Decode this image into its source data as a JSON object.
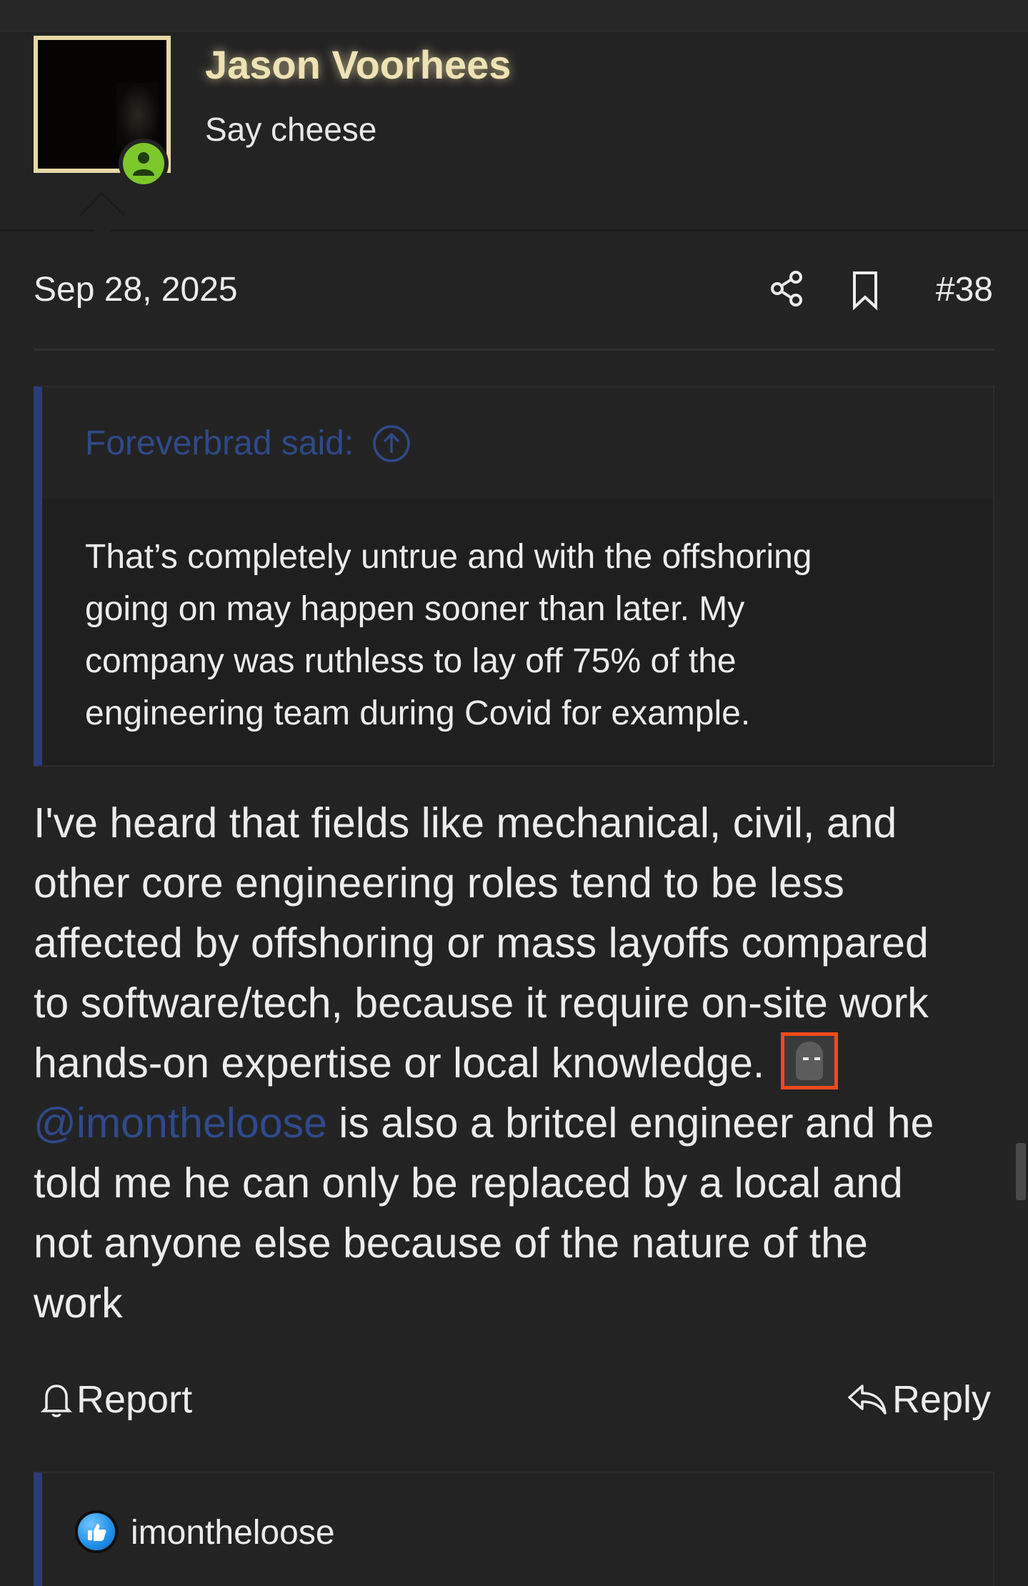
{
  "user": {
    "name": "Jason Voorhees",
    "title": "Say cheese"
  },
  "post": {
    "date": "Sep 28, 2025",
    "number": "#38",
    "share_icon": "share-icon",
    "bookmark_icon": "bookmark-icon"
  },
  "quote": {
    "author_label": "Foreverbrad said:",
    "lines": [
      "That’s completely untrue and with the offshoring",
      "going on may happen sooner than later. My",
      "company was ruthless to lay off 75% of the",
      "engineering team during Covid for example."
    ]
  },
  "message": {
    "lines": [
      "I've heard that fields like mechanical, civil, and",
      "other core engineering roles tend to be less",
      "affected by offshoring or mass layoffs compared",
      "to software/tech, because it require on-site work",
      "hands-on expertise or local knowledge."
    ],
    "mention": "@imontheloose",
    "mention_line_rest": " is also a britcel engineer and he",
    "trailing_lines": [
      "told me he can only be replaced by a local and",
      "not anyone else because of the nature of the",
      "work"
    ],
    "smilie_icon": "smirk-face-icon"
  },
  "actions": {
    "report_label": "Report",
    "reply_label": "Reply"
  },
  "reactions": {
    "users": [
      "imontheloose"
    ],
    "icon": "like-icon"
  },
  "colors": {
    "background": "#232323",
    "username": "#efe2b4",
    "link": "#2e4a8a",
    "quote_border": "#2b3d79",
    "online": "#7cc72a",
    "smilie_border": "#f04a1c"
  }
}
